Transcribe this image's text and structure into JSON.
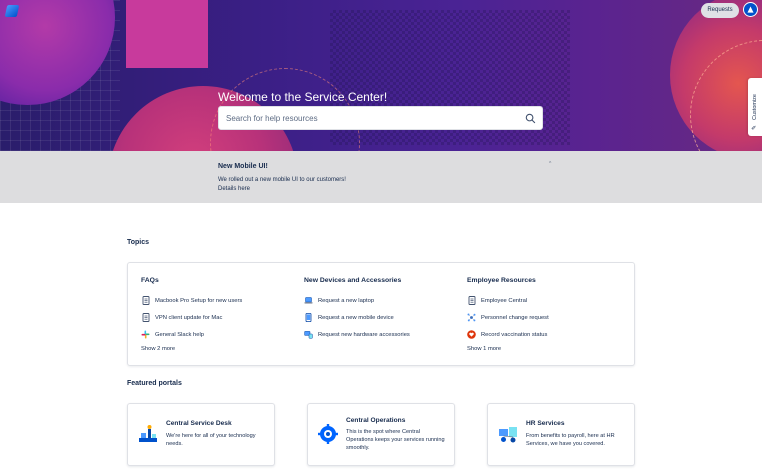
{
  "header": {
    "requests_label": "Requests",
    "customize_label": "Customize"
  },
  "hero": {
    "title": "Welcome to the Service Center!",
    "search_placeholder": "Search for help resources"
  },
  "banner": {
    "title": "New Mobile UI!",
    "body": "We rolled out a new mobile UI to our customers!",
    "link": "Details here"
  },
  "topics": {
    "label": "Topics",
    "columns": [
      {
        "title": "FAQs",
        "items": [
          {
            "label": "Macbook Pro Setup for new users",
            "icon": "document-icon"
          },
          {
            "label": "VPN client update for Mac",
            "icon": "document-icon"
          },
          {
            "label": "General Slack help",
            "icon": "slack-icon"
          }
        ],
        "show_more": "Show 2 more"
      },
      {
        "title": "New Devices and Accessories",
        "items": [
          {
            "label": "Request a new laptop",
            "icon": "laptop-icon"
          },
          {
            "label": "Request a new mobile device",
            "icon": "mobile-icon"
          },
          {
            "label": "Request new hardware accessories",
            "icon": "hardware-icon"
          }
        ],
        "show_more": ""
      },
      {
        "title": "Employee Resources",
        "items": [
          {
            "label": "Employee Central",
            "icon": "document-icon"
          },
          {
            "label": "Personnel change request",
            "icon": "people-network-icon"
          },
          {
            "label": "Record vaccination status",
            "icon": "heart-icon"
          }
        ],
        "show_more": "Show 1 more"
      }
    ]
  },
  "portals": {
    "label": "Featured portals",
    "items": [
      {
        "title": "Central Service Desk",
        "description": "We're here for all of your technology needs.",
        "icon": "service-desk-icon"
      },
      {
        "title": "Central Operations",
        "description": "This is the spot where Central Operations keeps your services running smoothly.",
        "icon": "gear-cloud-icon"
      },
      {
        "title": "HR Services",
        "description": "From benefits to payroll, here at HR Services, we have you covered.",
        "icon": "hr-icon"
      }
    ]
  },
  "colors": {
    "hero_base": "#3b1f86",
    "accent_pink": "#c83a9c",
    "brand_blue": "#0052cc",
    "banner_bg": "#dddddf"
  }
}
